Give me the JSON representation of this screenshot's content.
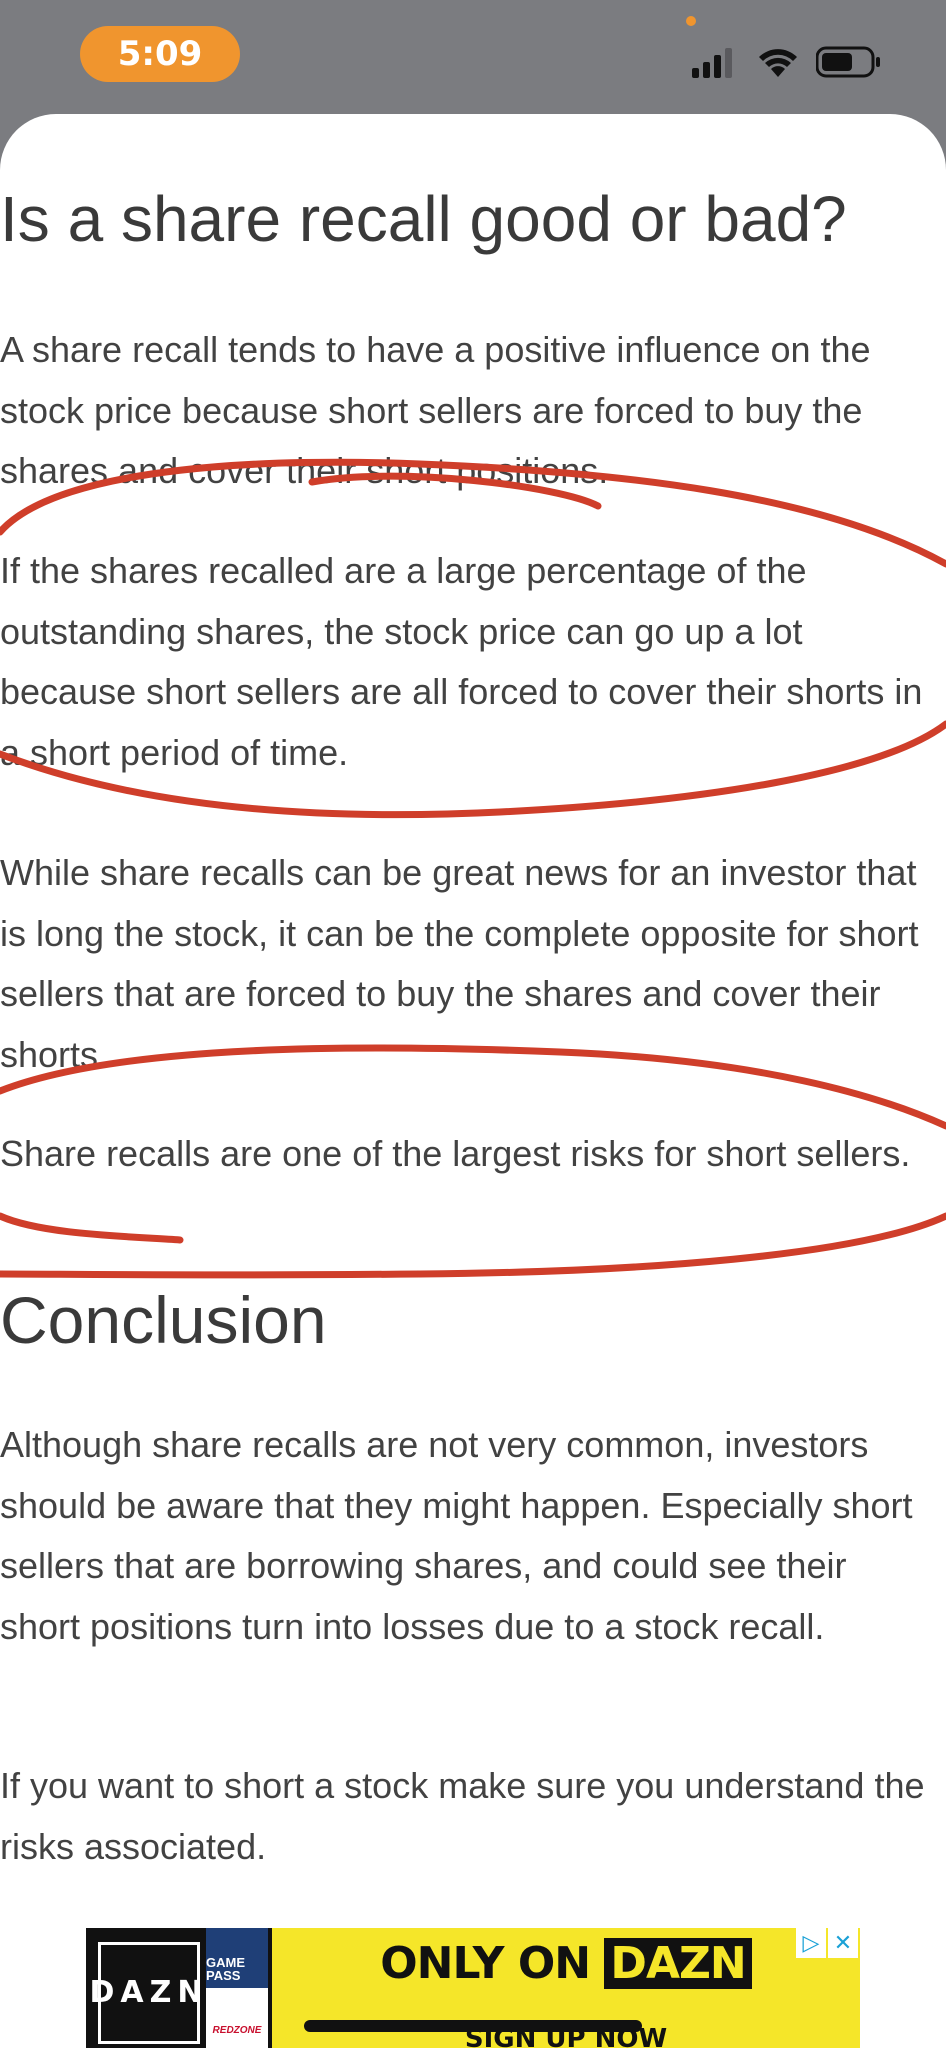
{
  "status_bar": {
    "time": "5:09",
    "icons": [
      "cellular-signal-icon",
      "wifi-icon",
      "battery-icon"
    ]
  },
  "article": {
    "heading": "Is a share recall good or bad?",
    "paragraphs": [
      "A share recall tends to have a positive influence on the stock price because short sellers are forced to buy the shares and cover their short positions.",
      "If the shares recalled are a large percentage of the outstanding shares, the stock price can go up a lot because short sellers are all forced to cover their shorts in a short period of time.",
      "While share recalls can be great news for an investor that is long the stock, it can be the complete opposite for short sellers that are forced to buy the shares and cover their shorts.",
      "Share recalls are one of the largest risks for short sellers."
    ],
    "conclusion_heading": "Conclusion",
    "conclusion_paragraphs": [
      "Although share recalls are not very common, investors should be aware that they might happen. Especially short sellers that are borrowing shares, and could see their short positions turn into losses due to a stock recall.",
      "If you want to short a stock make sure you understand the risks associated."
    ]
  },
  "ad": {
    "brand_logo": "DAZN",
    "game_pass": "GAME PASS",
    "redzone": "REDZONE",
    "headline_prefix": "ONLY ON",
    "headline_brand": "DAZN",
    "cta": "SIGN UP NOW",
    "icons": [
      "adchoices-icon",
      "close-icon"
    ]
  },
  "colors": {
    "status_bar_bg": "#7b7c80",
    "time_pill": "#f0952e",
    "annotation_ink": "#cf3e2a",
    "ad_yellow": "#f5e629"
  }
}
